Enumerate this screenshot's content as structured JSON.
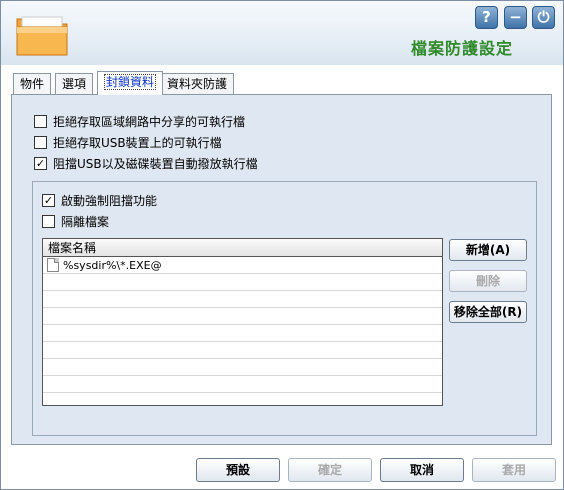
{
  "header": {
    "title": "檔案防護設定",
    "help_symbol": "?",
    "minimize_symbol": "−",
    "power_symbol": "⏻"
  },
  "tabs": [
    {
      "label": "物件"
    },
    {
      "label": "選項"
    },
    {
      "label": "封鎖資料",
      "active": true
    },
    {
      "label": "資料夾防護"
    }
  ],
  "options": [
    {
      "label": "拒絕存取區域網路中分享的可執行檔",
      "checked": false
    },
    {
      "label": "拒絕存取USB裝置上的可執行檔",
      "checked": false
    },
    {
      "label": "阻擋USB以及磁碟裝置自動撥放執行檔",
      "checked": true
    }
  ],
  "inner_options": [
    {
      "label": "啟動強制阻擋功能",
      "checked": true
    },
    {
      "label": "隔離檔案",
      "checked": false
    }
  ],
  "file_list": {
    "header": "檔案名稱",
    "rows": [
      "%sysdir%\\*.EXE@"
    ]
  },
  "side_buttons": {
    "add": "新增(A)",
    "remove": "刪除",
    "remove_all": "移除全部(R)"
  },
  "footer": {
    "default": "預設",
    "ok": "確定",
    "cancel": "取消",
    "apply": "套用"
  }
}
